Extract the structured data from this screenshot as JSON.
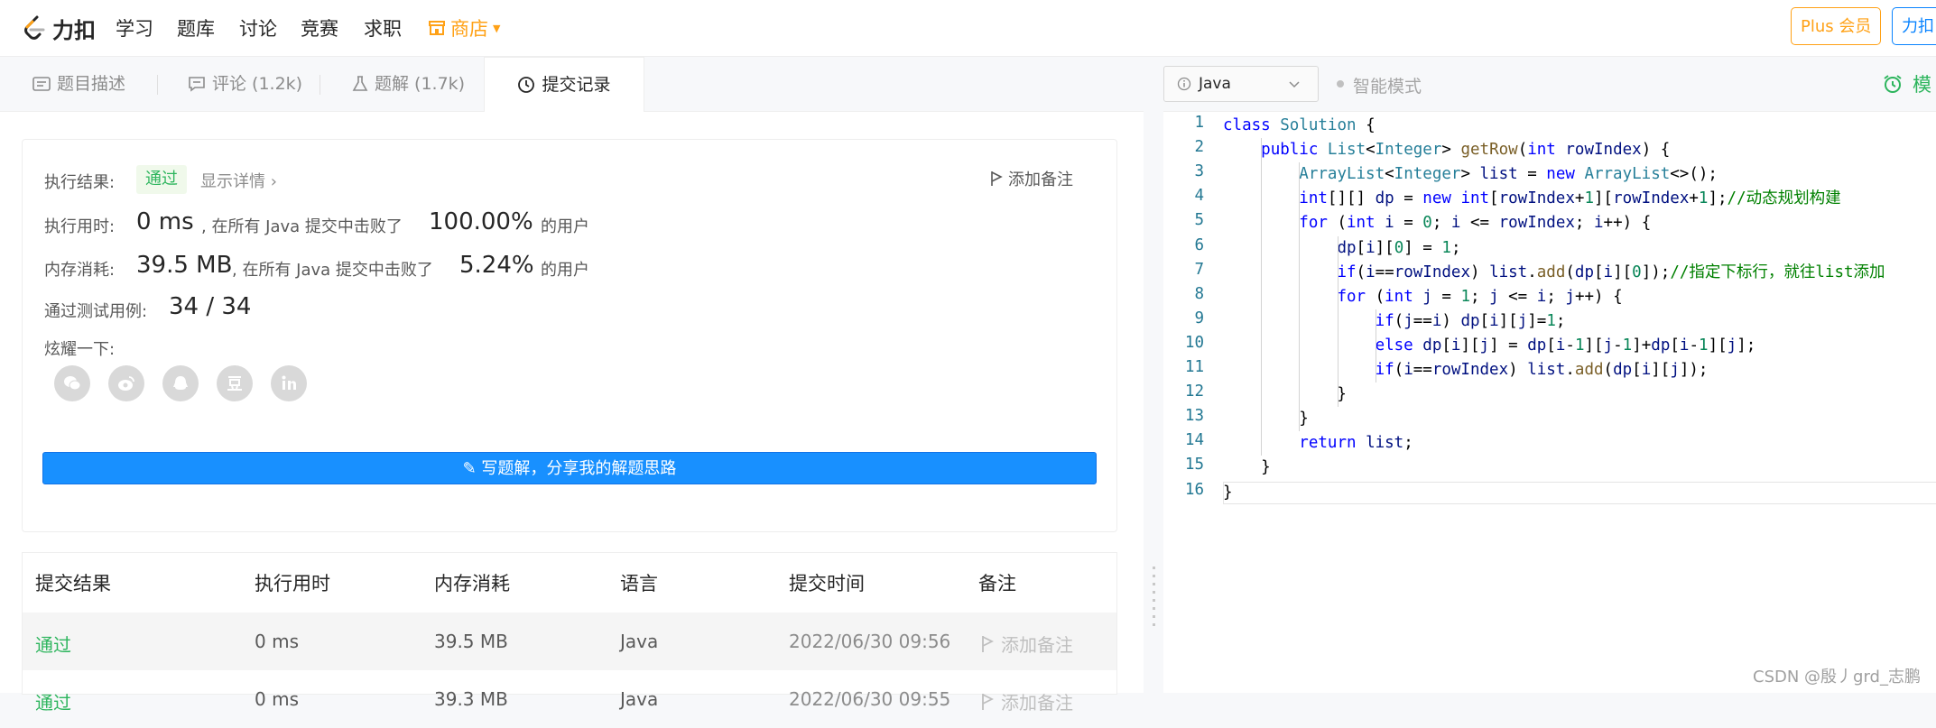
{
  "nav": {
    "logo_text": "力扣",
    "items": [
      "学习",
      "题库",
      "讨论",
      "竞赛",
      "求职"
    ],
    "shop": "商店",
    "plus_button": "Plus 会员",
    "right_button": "力扣"
  },
  "tabs": [
    {
      "label": "题目描述",
      "icon": "description-icon"
    },
    {
      "label": "评论 (1.2k)",
      "icon": "comment-icon"
    },
    {
      "label": "题解 (1.7k)",
      "icon": "flask-icon"
    },
    {
      "label": "提交记录",
      "icon": "clock-icon"
    }
  ],
  "result": {
    "label_result": "执行结果:",
    "status": "通过",
    "detail_link": "显示详情 ›",
    "add_note": "添加备注",
    "label_time": "执行用时:",
    "time_value": "0 ms",
    "time_text": ", 在所有 Java 提交中击败了",
    "time_percent": "100.00%",
    "time_suffix": "的用户",
    "label_memory": "内存消耗:",
    "memory_value": "39.5 MB",
    "memory_text": ", 在所有 Java 提交中击败了",
    "memory_percent": "5.24%",
    "memory_suffix": "的用户",
    "label_tests": "通过测试用例:",
    "tests_value": "34 / 34",
    "label_share": "炫耀一下:",
    "share_icons": [
      "wechat-icon",
      "weibo-icon",
      "qq-icon",
      "douban-icon",
      "linkedin-icon"
    ],
    "write_button": "写题解，分享我的解题思路"
  },
  "submissions": {
    "headers": [
      "提交结果",
      "执行用时",
      "内存消耗",
      "语言",
      "提交时间",
      "备注"
    ],
    "rows": [
      {
        "result": "通过",
        "time": "0 ms",
        "memory": "39.5 MB",
        "lang": "Java",
        "submitted": "2022/06/30 09:56",
        "note": "添加备注"
      },
      {
        "result": "通过",
        "time": "0 ms",
        "memory": "39.3 MB",
        "lang": "Java",
        "submitted": "2022/06/30 09:55",
        "note": "添加备注"
      }
    ]
  },
  "editor": {
    "language": "Java",
    "smart_mode": "智能模式",
    "mock_label": "模",
    "lines": [
      "class Solution {",
      "    public List<Integer> getRow(int rowIndex) {",
      "        ArrayList<Integer> list = new ArrayList<>();",
      "        int[][] dp = new int[rowIndex+1][rowIndex+1];//动态规划构建",
      "        for (int i = 0; i <= rowIndex; i++) {",
      "            dp[i][0] = 1;",
      "            if(i==rowIndex) list.add(dp[i][0]);//指定下标行，就往list添加",
      "            for (int j = 1; j <= i; j++) {",
      "                if(j==i) dp[i][j]=1;",
      "                else dp[i][j] = dp[i-1][j-1]+dp[i-1][j];",
      "                if(i==rowIndex) list.add(dp[i][j]);",
      "            }",
      "        }",
      "        return list;",
      "    }",
      "}"
    ]
  },
  "watermark": "CSDN @殷丿grd_志鹏"
}
